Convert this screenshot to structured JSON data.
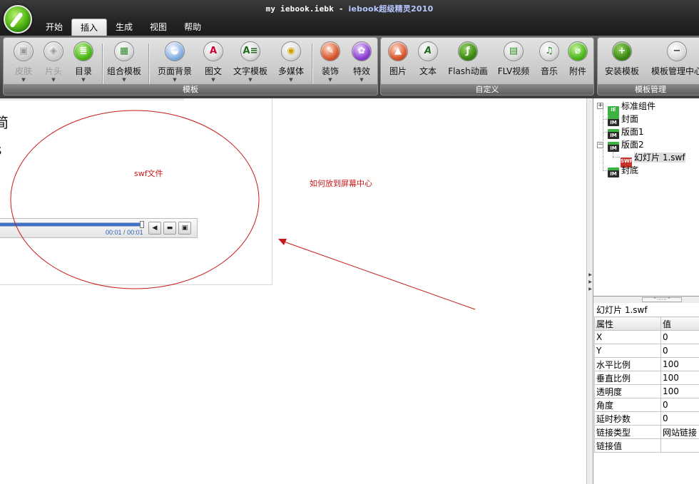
{
  "window": {
    "title": "my iebook.iebk - ",
    "title_suffix": "iebook超级精灵2010"
  },
  "tabs": [
    "开始",
    "插入",
    "生成",
    "视图",
    "帮助"
  ],
  "active_tab": "插入",
  "ribbon": {
    "groups": [
      {
        "label": "模板",
        "buttons": [
          {
            "label": "皮肤",
            "icon": "skin-icon",
            "enabled": false,
            "dropdown": true
          },
          {
            "label": "片头",
            "icon": "intro-icon",
            "enabled": false,
            "dropdown": true
          },
          {
            "label": "目录",
            "icon": "toc-icon",
            "enabled": true,
            "dropdown": true
          },
          {
            "label": "组合模板",
            "icon": "combo-template-icon",
            "enabled": true,
            "dropdown": true
          },
          {
            "label": "页面背景",
            "icon": "page-background-icon",
            "enabled": true,
            "dropdown": true
          },
          {
            "label": "图文",
            "icon": "image-text-icon",
            "enabled": true,
            "dropdown": true
          },
          {
            "label": "文字模板",
            "icon": "text-template-icon",
            "enabled": true,
            "dropdown": true
          },
          {
            "label": "多媒体",
            "icon": "multimedia-icon",
            "enabled": true,
            "dropdown": true
          },
          {
            "label": "装饰",
            "icon": "decoration-icon",
            "enabled": true,
            "dropdown": true
          },
          {
            "label": "特效",
            "icon": "effects-icon",
            "enabled": true,
            "dropdown": true
          }
        ]
      },
      {
        "label": "自定义",
        "buttons": [
          {
            "label": "图片",
            "icon": "picture-icon",
            "enabled": true,
            "dropdown": false
          },
          {
            "label": "文本",
            "icon": "text-icon",
            "enabled": true,
            "dropdown": false
          },
          {
            "label": "Flash动画",
            "icon": "flash-icon",
            "enabled": true,
            "dropdown": false
          },
          {
            "label": "FLV视频",
            "icon": "flv-video-icon",
            "enabled": true,
            "dropdown": false
          },
          {
            "label": "音乐",
            "icon": "music-icon",
            "enabled": true,
            "dropdown": false
          },
          {
            "label": "附件",
            "icon": "attachment-icon",
            "enabled": true,
            "dropdown": false
          }
        ]
      },
      {
        "label": "模板管理",
        "buttons": [
          {
            "label": "安装模板",
            "icon": "install-template-icon",
            "enabled": true,
            "dropdown": false
          },
          {
            "label": "模板管理中心",
            "icon": "template-center-icon",
            "enabled": true,
            "dropdown": false
          }
        ]
      }
    ]
  },
  "canvas": {
    "partial_text": [
      "简",
      "s"
    ],
    "swf_label": "swf文件",
    "note": "如何放到屏幕中心",
    "player": {
      "time_current": "00:01",
      "time_separator": "/",
      "time_total": "00:01",
      "progress": 1.0
    },
    "annotation_color": "#c81818"
  },
  "tree": {
    "items": [
      {
        "label": "标准组件",
        "icon": "std-component-icon",
        "badge": "IE",
        "toggle": "+"
      },
      {
        "label": "封面",
        "icon": "page-icon",
        "badge": "IM"
      },
      {
        "label": "版面1",
        "icon": "page-icon",
        "badge": "IM"
      },
      {
        "label": "版面2",
        "icon": "page-icon",
        "badge": "IM",
        "toggle": "−"
      },
      {
        "label": "幻灯片 1.swf",
        "icon": "swf-file-icon",
        "badge": "SWF",
        "selected": true
      },
      {
        "label": "封底",
        "icon": "page-icon",
        "badge": "IM"
      }
    ]
  },
  "properties": {
    "title": "幻灯片 1.swf",
    "headers": {
      "name": "属性",
      "value": "值"
    },
    "rows": [
      {
        "name": "X",
        "value": "0"
      },
      {
        "name": "Y",
        "value": "0"
      },
      {
        "name": "水平比例",
        "value": "100"
      },
      {
        "name": "垂直比例",
        "value": "100"
      },
      {
        "name": "透明度",
        "value": "100"
      },
      {
        "name": "角度",
        "value": "0"
      },
      {
        "name": "延时秒数",
        "value": "0"
      },
      {
        "name": "链接类型",
        "value": "网站链接"
      },
      {
        "name": "链接值",
        "value": ""
      }
    ]
  }
}
